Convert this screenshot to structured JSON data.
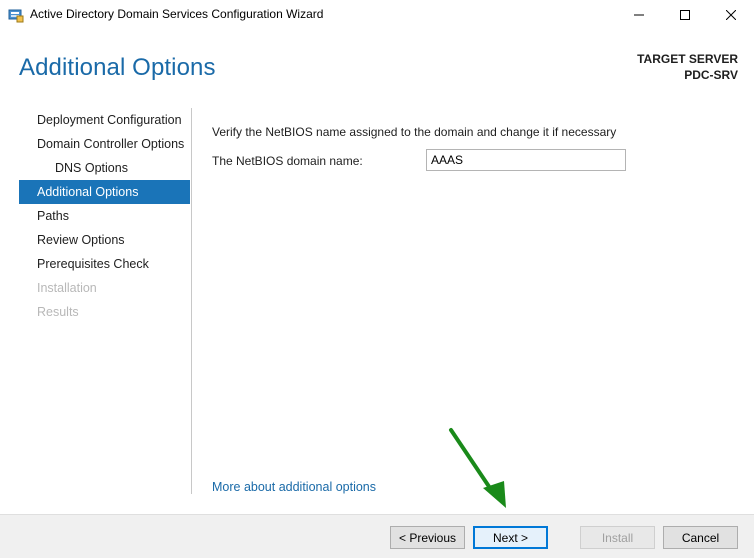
{
  "window": {
    "title": "Active Directory Domain Services Configuration Wizard"
  },
  "header": {
    "page_title": "Additional Options",
    "target_label": "TARGET SERVER",
    "target_name": "PDC-SRV"
  },
  "nav": {
    "items": [
      {
        "label": "Deployment Configuration",
        "state": "normal"
      },
      {
        "label": "Domain Controller Options",
        "state": "normal"
      },
      {
        "label": "DNS Options",
        "state": "normal"
      },
      {
        "label": "Additional Options",
        "state": "active"
      },
      {
        "label": "Paths",
        "state": "normal"
      },
      {
        "label": "Review Options",
        "state": "normal"
      },
      {
        "label": "Prerequisites Check",
        "state": "normal"
      },
      {
        "label": "Installation",
        "state": "disabled"
      },
      {
        "label": "Results",
        "state": "disabled"
      }
    ]
  },
  "main": {
    "instruction": "Verify the NetBIOS name assigned to the domain and change it if necessary",
    "netbios_label": "The NetBIOS domain name:",
    "netbios_value": "AAAS",
    "more_link": "More about additional options"
  },
  "footer": {
    "previous_label": "< Previous",
    "next_label": "Next >",
    "install_label": "Install",
    "cancel_label": "Cancel"
  },
  "colors": {
    "accent": "#1a74b8",
    "title_blue": "#1a6aa8",
    "annotation_arrow": "#1a8a1a"
  }
}
